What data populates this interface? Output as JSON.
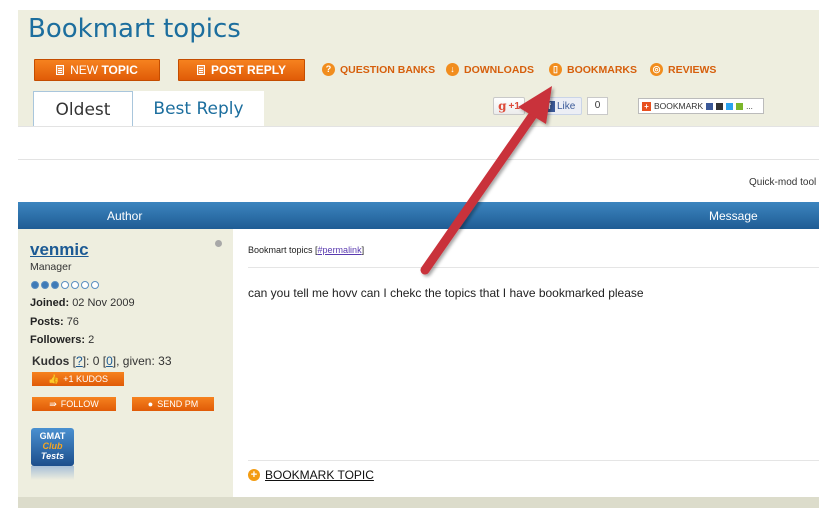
{
  "page": {
    "title": "Bookmart topics"
  },
  "toolbar": {
    "new_topic": {
      "prefix": "NEW",
      "main": "TOPIC"
    },
    "post_reply": "POST REPLY",
    "links": {
      "question_banks": "QUESTION BANKS",
      "downloads": "DOWNLOADS",
      "bookmarks": "BOOKMARKS",
      "reviews": "REVIEWS"
    }
  },
  "tabs": {
    "oldest": "Oldest",
    "best_reply": "Best Reply"
  },
  "social": {
    "gplus_label": "+1",
    "fb_like_label": "Like",
    "fb_like_count": "0",
    "addthis_label": "BOOKMARK"
  },
  "quickmod": "Quick-mod tool",
  "table_header": {
    "author": "Author",
    "message": "Message"
  },
  "author": {
    "username": "venmic",
    "rank": "Manager",
    "rank_level": 3,
    "rank_max": 7,
    "joined_label": "Joined:",
    "joined_value": "02 Nov 2009",
    "posts_label": "Posts:",
    "posts_value": "76",
    "followers_label": "Followers:",
    "followers_value": "2",
    "kudos_label": "Kudos",
    "kudos_help": "?",
    "kudos_count": "0",
    "kudos_received_link": "0",
    "kudos_given_label": "given:",
    "kudos_given_value": "33",
    "kudos_button": "+1 KUDOS",
    "follow_button": "FOLLOW",
    "send_pm_button": "SEND PM",
    "badge": {
      "line1": "GMAT",
      "line2": "Club",
      "line3": "Tests"
    }
  },
  "message": {
    "title": "Bookmart topics",
    "permalink": "#permalink",
    "body": "can you tell me hovv can I chekc the topics that I have bookmarked please",
    "bookmark_topic": "BOOKMARK TOPIC"
  },
  "colors": {
    "accent_orange": "#f07b18",
    "title_blue": "#1c6e9e",
    "header_blue": "#2a6ca8",
    "annotation_arrow": "#c9303a"
  }
}
